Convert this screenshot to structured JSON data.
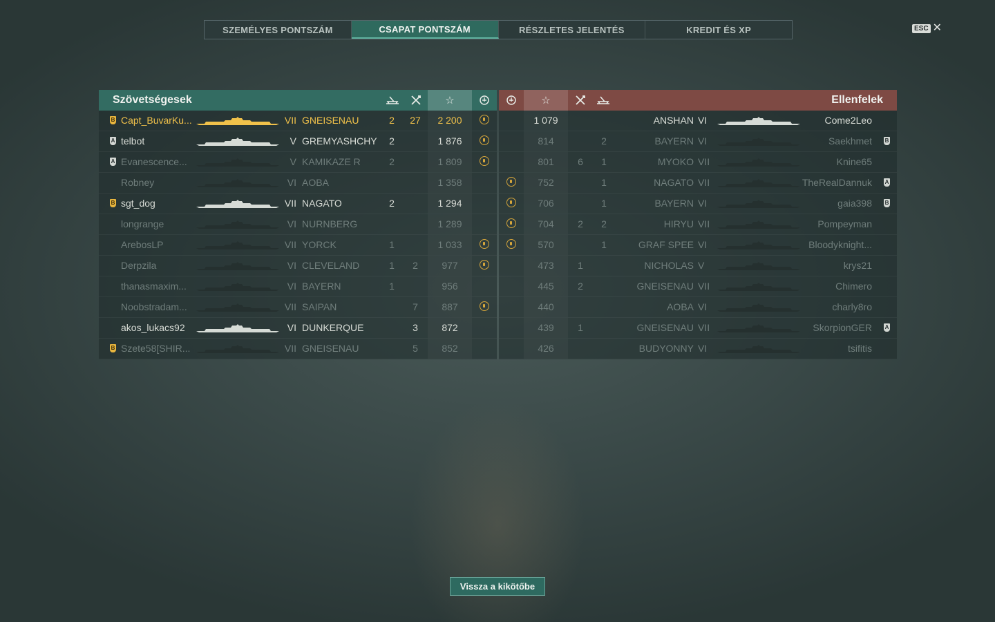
{
  "tabs": [
    {
      "label": "SZEMÉLYES PONTSZÁM",
      "active": false
    },
    {
      "label": "CSAPAT PONTSZÁM",
      "active": true
    },
    {
      "label": "RÉSZLETES JELENTÉS",
      "active": false
    },
    {
      "label": "KREDIT ÉS XP",
      "active": false
    }
  ],
  "close": {
    "key_label": "ESC",
    "icon": "close-icon"
  },
  "allies": {
    "title": "Szövetségesek",
    "columns": [
      "ship-sunk-icon",
      "kills-icon",
      "star-icon",
      "medal-icon"
    ],
    "rows": [
      {
        "rank": "B",
        "name": "Capt_BuvarKu...",
        "tier": "VII",
        "ship": "GNEISENAU",
        "a": "2",
        "b": "27",
        "score": "2 200",
        "medal": true,
        "style": "self"
      },
      {
        "rank": "A",
        "name": "telbot",
        "tier": "V",
        "ship": "GREMYASHCHY",
        "a": "2",
        "b": "",
        "score": "1 876",
        "medal": true,
        "style": "alive"
      },
      {
        "rank": "A",
        "name": "Evanescence...",
        "tier": "V",
        "ship": "KAMIKAZE R",
        "a": "2",
        "b": "",
        "score": "1 809",
        "medal": true,
        "style": "dim"
      },
      {
        "rank": "",
        "name": "Robney",
        "tier": "VI",
        "ship": "AOBA",
        "a": "",
        "b": "",
        "score": "1 358",
        "medal": false,
        "style": "dim"
      },
      {
        "rank": "B",
        "name": "sgt_dog",
        "tier": "VII",
        "ship": "NAGATO",
        "a": "2",
        "b": "",
        "score": "1 294",
        "medal": false,
        "style": "alive"
      },
      {
        "rank": "",
        "name": "longrange",
        "tier": "VI",
        "ship": "NURNBERG",
        "a": "",
        "b": "",
        "score": "1 289",
        "medal": false,
        "style": "dim"
      },
      {
        "rank": "",
        "name": "ArebosLP",
        "tier": "VII",
        "ship": "YORCK",
        "a": "1",
        "b": "",
        "score": "1 033",
        "medal": true,
        "style": "dim"
      },
      {
        "rank": "",
        "name": "Derpzila",
        "tier": "VI",
        "ship": "CLEVELAND",
        "a": "1",
        "b": "2",
        "score": "977",
        "medal": true,
        "style": "dim"
      },
      {
        "rank": "",
        "name": "thanasmaxim...",
        "tier": "VI",
        "ship": "BAYERN",
        "a": "1",
        "b": "",
        "score": "956",
        "medal": false,
        "style": "dim"
      },
      {
        "rank": "",
        "name": "Noobstradam...",
        "tier": "VII",
        "ship": "SAIPAN",
        "a": "",
        "b": "7",
        "score": "887",
        "medal": true,
        "style": "dim"
      },
      {
        "rank": "",
        "name": "akos_lukacs92",
        "tier": "VI",
        "ship": "DUNKERQUE",
        "a": "",
        "b": "3",
        "score": "872",
        "medal": false,
        "style": "alive"
      },
      {
        "rank": "B",
        "name": "Szete58[SHIR...",
        "tier": "VII",
        "ship": "GNEISENAU",
        "a": "",
        "b": "5",
        "score": "852",
        "medal": false,
        "style": "dim"
      }
    ]
  },
  "enemies": {
    "title": "Ellenfelek",
    "columns": [
      "medal-icon",
      "star-icon",
      "kills-icon",
      "ship-sunk-icon"
    ],
    "rows": [
      {
        "medal": false,
        "score": "1 079",
        "b": "",
        "a": "",
        "ship": "ANSHAN",
        "tier": "VI",
        "name": "Come2Leo",
        "rank": "",
        "style": "alive"
      },
      {
        "medal": false,
        "score": "814",
        "b": "",
        "a": "2",
        "ship": "BAYERN",
        "tier": "VI",
        "name": "Saekhmet",
        "rank": "B",
        "style": "dim"
      },
      {
        "medal": false,
        "score": "801",
        "b": "6",
        "a": "1",
        "ship": "MYOKO",
        "tier": "VII",
        "name": "Knine65",
        "rank": "",
        "style": "dim"
      },
      {
        "medal": true,
        "score": "752",
        "b": "",
        "a": "1",
        "ship": "NAGATO",
        "tier": "VII",
        "name": "TheRealDannuk",
        "rank": "A",
        "style": "dim"
      },
      {
        "medal": true,
        "score": "706",
        "b": "",
        "a": "1",
        "ship": "BAYERN",
        "tier": "VI",
        "name": "gaia398",
        "rank": "B",
        "style": "dim"
      },
      {
        "medal": true,
        "score": "704",
        "b": "2",
        "a": "2",
        "ship": "HIRYU",
        "tier": "VII",
        "name": "Pompeyman",
        "rank": "",
        "style": "dim"
      },
      {
        "medal": true,
        "score": "570",
        "b": "",
        "a": "1",
        "ship": "GRAF SPEE",
        "tier": "VI",
        "name": "Bloodyknight...",
        "rank": "",
        "style": "dim"
      },
      {
        "medal": false,
        "score": "473",
        "b": "1",
        "a": "",
        "ship": "NICHOLAS",
        "tier": "V",
        "name": "krys21",
        "rank": "",
        "style": "dim"
      },
      {
        "medal": false,
        "score": "445",
        "b": "2",
        "a": "",
        "ship": "GNEISENAU",
        "tier": "VII",
        "name": "Chimero",
        "rank": "",
        "style": "dim"
      },
      {
        "medal": false,
        "score": "440",
        "b": "",
        "a": "",
        "ship": "AOBA",
        "tier": "VI",
        "name": "charly8ro",
        "rank": "",
        "style": "dim"
      },
      {
        "medal": false,
        "score": "439",
        "b": "1",
        "a": "",
        "ship": "GNEISENAU",
        "tier": "VII",
        "name": "SkorpionGER",
        "rank": "A",
        "style": "dim"
      },
      {
        "medal": false,
        "score": "426",
        "b": "",
        "a": "",
        "ship": "BUDYONNY",
        "tier": "VI",
        "name": "tsifitis",
        "rank": "",
        "style": "dim"
      }
    ]
  },
  "back_button": {
    "label": "Vissza a kikötőbe"
  },
  "colors": {
    "self": "#f0c14a",
    "alive": "#d8dcd6",
    "dim": "#6f7d7b",
    "ally_header": "#336c62",
    "enemy_header": "#7e4a44"
  }
}
